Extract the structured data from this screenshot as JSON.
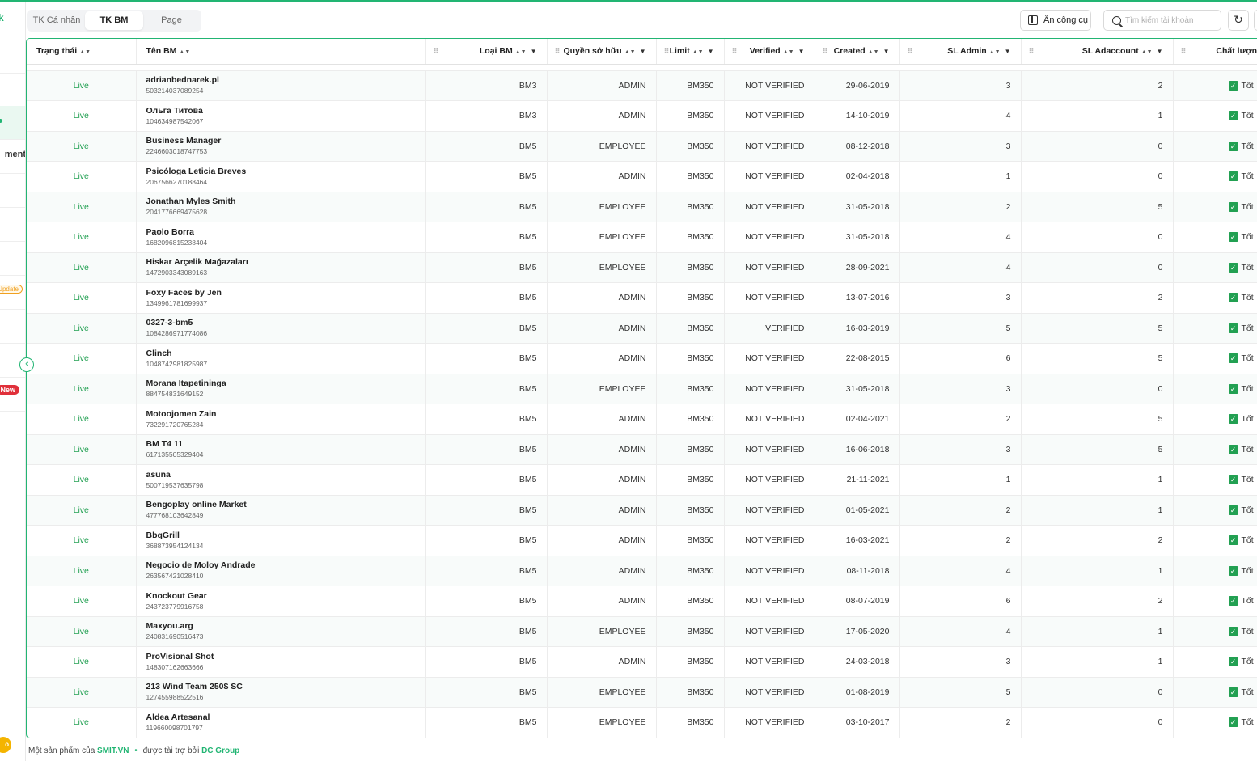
{
  "tabs": [
    {
      "label": "TK Cá nhân"
    },
    {
      "label": "TK BM"
    },
    {
      "label": "Page"
    }
  ],
  "toolbar": {
    "tools_label": "Ẩn công cụ",
    "search_placeholder": "Tìm kiếm tài khoản",
    "refresh_icon": "↻"
  },
  "sidebar": {
    "logo": "k",
    "item_text": "ment",
    "update_badge": "Update",
    "new_badge": "New",
    "bottom_badge": "o",
    "collapse_icon": "‹"
  },
  "columns": {
    "status": "Trạng thái",
    "name": "Tên BM",
    "type": "Loại BM",
    "role": "Quyền sở hữu",
    "limit": "Limit",
    "verified": "Verified",
    "created": "Created",
    "admins": "SL Admin",
    "adaccounts": "SL Adaccount",
    "quality": "Chất lượng"
  },
  "rows": [
    {
      "status": "Live",
      "name": "adrianbednarek.pl",
      "id": "503214037089254",
      "type": "BM3",
      "role": "ADMIN",
      "limit": "BM350",
      "verified": "NOT VERIFIED",
      "created": "29-06-2019",
      "admins": "3",
      "adaccounts": "2",
      "quality": "Tốt"
    },
    {
      "status": "Live",
      "name": "Ольга Титова",
      "id": "104634987542067",
      "type": "BM3",
      "role": "ADMIN",
      "limit": "BM350",
      "verified": "NOT VERIFIED",
      "created": "14-10-2019",
      "admins": "4",
      "adaccounts": "1",
      "quality": "Tốt"
    },
    {
      "status": "Live",
      "name": "Business Manager",
      "id": "2246603018747753",
      "type": "BM5",
      "role": "EMPLOYEE",
      "limit": "BM350",
      "verified": "NOT VERIFIED",
      "created": "08-12-2018",
      "admins": "3",
      "adaccounts": "0",
      "quality": "Tốt"
    },
    {
      "status": "Live",
      "name": "Psicóloga Leticia Breves",
      "id": "2067566270188464",
      "type": "BM5",
      "role": "ADMIN",
      "limit": "BM350",
      "verified": "NOT VERIFIED",
      "created": "02-04-2018",
      "admins": "1",
      "adaccounts": "0",
      "quality": "Tốt"
    },
    {
      "status": "Live",
      "name": "Jonathan Myles Smith",
      "id": "2041776669475628",
      "type": "BM5",
      "role": "EMPLOYEE",
      "limit": "BM350",
      "verified": "NOT VERIFIED",
      "created": "31-05-2018",
      "admins": "2",
      "adaccounts": "5",
      "quality": "Tốt"
    },
    {
      "status": "Live",
      "name": "Paolo Borra",
      "id": "1682096815238404",
      "type": "BM5",
      "role": "EMPLOYEE",
      "limit": "BM350",
      "verified": "NOT VERIFIED",
      "created": "31-05-2018",
      "admins": "4",
      "adaccounts": "0",
      "quality": "Tốt"
    },
    {
      "status": "Live",
      "name": "Hiskar Arçelik Mağazaları",
      "id": "1472903343089163",
      "type": "BM5",
      "role": "EMPLOYEE",
      "limit": "BM350",
      "verified": "NOT VERIFIED",
      "created": "28-09-2021",
      "admins": "4",
      "adaccounts": "0",
      "quality": "Tốt"
    },
    {
      "status": "Live",
      "name": "Foxy Faces by Jen",
      "id": "1349961781699937",
      "type": "BM5",
      "role": "ADMIN",
      "limit": "BM350",
      "verified": "NOT VERIFIED",
      "created": "13-07-2016",
      "admins": "3",
      "adaccounts": "2",
      "quality": "Tốt"
    },
    {
      "status": "Live",
      "name": "0327-3-bm5",
      "id": "1084286971774086",
      "type": "BM5",
      "role": "ADMIN",
      "limit": "BM350",
      "verified": "VERIFIED",
      "created": "16-03-2019",
      "admins": "5",
      "adaccounts": "5",
      "quality": "Tốt"
    },
    {
      "status": "Live",
      "name": "Clinch",
      "id": "1048742981825987",
      "type": "BM5",
      "role": "ADMIN",
      "limit": "BM350",
      "verified": "NOT VERIFIED",
      "created": "22-08-2015",
      "admins": "6",
      "adaccounts": "5",
      "quality": "Tốt"
    },
    {
      "status": "Live",
      "name": "Morana Itapetininga",
      "id": "884754831649152",
      "type": "BM5",
      "role": "EMPLOYEE",
      "limit": "BM350",
      "verified": "NOT VERIFIED",
      "created": "31-05-2018",
      "admins": "3",
      "adaccounts": "0",
      "quality": "Tốt"
    },
    {
      "status": "Live",
      "name": "Motoojomen Zain",
      "id": "732291720765284",
      "type": "BM5",
      "role": "ADMIN",
      "limit": "BM350",
      "verified": "NOT VERIFIED",
      "created": "02-04-2021",
      "admins": "2",
      "adaccounts": "5",
      "quality": "Tốt"
    },
    {
      "status": "Live",
      "name": "BM T4 11",
      "id": "617135505329404",
      "type": "BM5",
      "role": "ADMIN",
      "limit": "BM350",
      "verified": "NOT VERIFIED",
      "created": "16-06-2018",
      "admins": "3",
      "adaccounts": "5",
      "quality": "Tốt"
    },
    {
      "status": "Live",
      "name": "asuna",
      "id": "500719537635798",
      "type": "BM5",
      "role": "ADMIN",
      "limit": "BM350",
      "verified": "NOT VERIFIED",
      "created": "21-11-2021",
      "admins": "1",
      "adaccounts": "1",
      "quality": "Tốt"
    },
    {
      "status": "Live",
      "name": "Bengoplay online Market",
      "id": "477768103642849",
      "type": "BM5",
      "role": "ADMIN",
      "limit": "BM350",
      "verified": "NOT VERIFIED",
      "created": "01-05-2021",
      "admins": "2",
      "adaccounts": "1",
      "quality": "Tốt"
    },
    {
      "status": "Live",
      "name": "BbqGrill",
      "id": "368873954124134",
      "type": "BM5",
      "role": "ADMIN",
      "limit": "BM350",
      "verified": "NOT VERIFIED",
      "created": "16-03-2021",
      "admins": "2",
      "adaccounts": "2",
      "quality": "Tốt"
    },
    {
      "status": "Live",
      "name": "Negocio de Moloy Andrade",
      "id": "263567421028410",
      "type": "BM5",
      "role": "ADMIN",
      "limit": "BM350",
      "verified": "NOT VERIFIED",
      "created": "08-11-2018",
      "admins": "4",
      "adaccounts": "1",
      "quality": "Tốt"
    },
    {
      "status": "Live",
      "name": "Knockout Gear",
      "id": "243723779916758",
      "type": "BM5",
      "role": "ADMIN",
      "limit": "BM350",
      "verified": "NOT VERIFIED",
      "created": "08-07-2019",
      "admins": "6",
      "adaccounts": "2",
      "quality": "Tốt"
    },
    {
      "status": "Live",
      "name": "Maxyou.arg",
      "id": "240831690516473",
      "type": "BM5",
      "role": "EMPLOYEE",
      "limit": "BM350",
      "verified": "NOT VERIFIED",
      "created": "17-05-2020",
      "admins": "4",
      "adaccounts": "1",
      "quality": "Tốt"
    },
    {
      "status": "Live",
      "name": "ProVisional Shot",
      "id": "148307162663666",
      "type": "BM5",
      "role": "ADMIN",
      "limit": "BM350",
      "verified": "NOT VERIFIED",
      "created": "24-03-2018",
      "admins": "3",
      "adaccounts": "1",
      "quality": "Tốt"
    },
    {
      "status": "Live",
      "name": "213 Wind Team 250$ SC",
      "id": "127455988522516",
      "type": "BM5",
      "role": "EMPLOYEE",
      "limit": "BM350",
      "verified": "NOT VERIFIED",
      "created": "01-08-2019",
      "admins": "5",
      "adaccounts": "0",
      "quality": "Tốt"
    },
    {
      "status": "Live",
      "name": "Aldea Artesanal",
      "id": "119660098701797",
      "type": "BM5",
      "role": "EMPLOYEE",
      "limit": "BM350",
      "verified": "NOT VERIFIED",
      "created": "03-10-2017",
      "admins": "2",
      "adaccounts": "0",
      "quality": "Tốt"
    }
  ],
  "footer": {
    "prefix": "Một sản phẩm của",
    "brand": "SMIT.VN",
    "middle": "được tài trợ bởi",
    "sponsor": "DC Group"
  },
  "colors": {
    "accent": "#22b573",
    "status_live": "#22a052",
    "badge_new": "#e0303a",
    "badge_update": "#f0a020"
  }
}
